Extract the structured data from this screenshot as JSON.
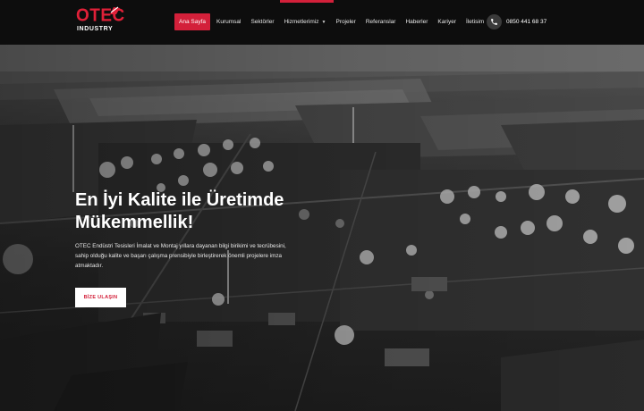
{
  "brand": {
    "name": "OTEC",
    "sub": "INDUSTRY",
    "accent": "#d3203a"
  },
  "nav": {
    "items": [
      {
        "label": "Ana Sayfa",
        "active": true
      },
      {
        "label": "Kurumsal"
      },
      {
        "label": "Sektörler"
      },
      {
        "label": "Hizmetlerimiz",
        "dropdown": true
      },
      {
        "label": "Projeler"
      },
      {
        "label": "Referanslar"
      },
      {
        "label": "Haberler"
      },
      {
        "label": "Kariyer"
      },
      {
        "label": "İletisim"
      }
    ]
  },
  "contact": {
    "phone": "0850 441 68 37",
    "icon": "phone-icon"
  },
  "hero": {
    "title_line1": "En İyi Kalite ile Üretimde",
    "title_line2": "Mükemmellik!",
    "description": "OTEC Endüstri Tesisleri İmalat ve Montaj yıllara dayanan bilgi birikimi ve tecrübesini, sahip olduğu kalite ve başarı çalışma prensibiyle birleştirerek önemli projelere imza atmaktadır.",
    "cta_label": "BİZE ULAŞIN"
  }
}
